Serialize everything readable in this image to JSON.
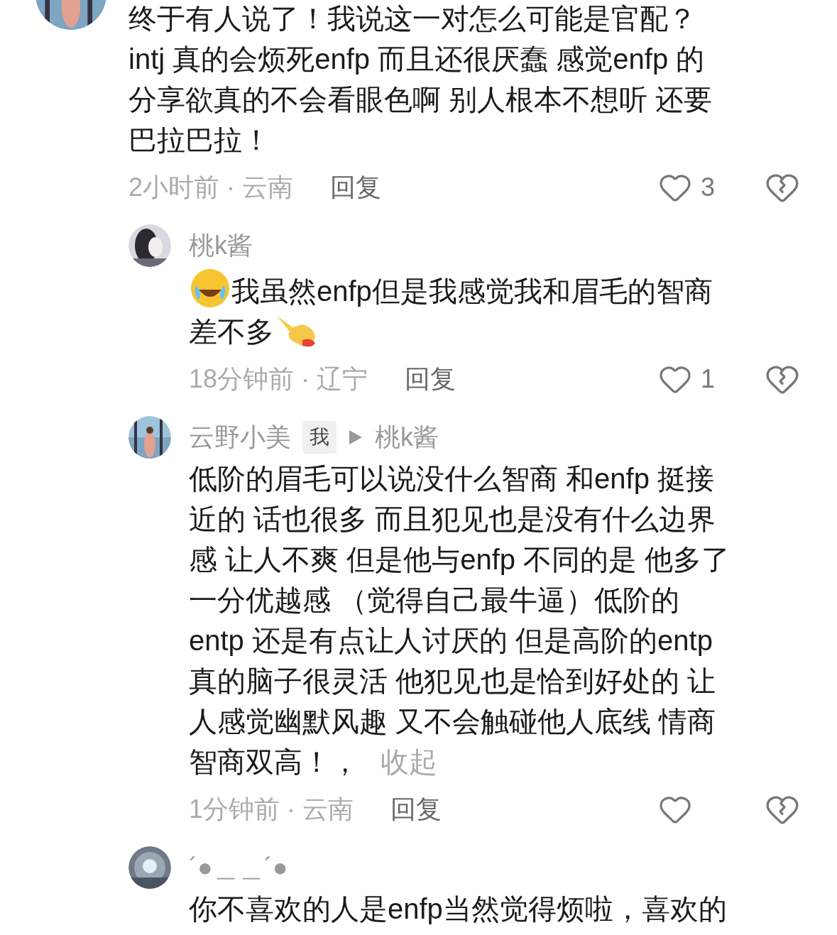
{
  "comment": {
    "lines": [
      [
        {
          "kind": "text",
          "text": "终于有人说了！我说这一对怎么可能是官配？"
        }
      ],
      [
        {
          "kind": "text",
          "text": "intj 真的会烦死enfp 而且还很厌蠢 感觉enfp 的"
        }
      ],
      [
        {
          "kind": "text",
          "text": "分享欲真的不会看眼色啊 别人根本不想听 还要"
        }
      ],
      [
        {
          "kind": "text",
          "text": "巴拉巴拉！"
        }
      ]
    ],
    "time": "2小时前 · 云南",
    "reply": "回复",
    "likes": "3"
  },
  "replies": [
    {
      "name": "桃k酱",
      "lines": [
        [
          {
            "kind": "laugh_emoji"
          },
          {
            "kind": "text",
            "text": "我虽然enfp但是我感觉我和眉毛的智商"
          }
        ],
        [
          {
            "kind": "text",
            "text": "差不多"
          },
          {
            "kind": "point_emoji"
          }
        ]
      ],
      "time": "18分钟前 · 辽宁",
      "reply": "回复",
      "likes": "1"
    },
    {
      "name": "云野小美",
      "badge": "我",
      "reply_to": "桃k酱",
      "lines": [
        [
          {
            "kind": "text",
            "text": "低阶的眉毛可以说没什么智商 和enfp 挺接"
          }
        ],
        [
          {
            "kind": "text",
            "text": "近的 话也很多 而且犯见也是没有什么边界"
          }
        ],
        [
          {
            "kind": "text",
            "text": "感 让人不爽 但是他与enfp 不同的是 他多了"
          }
        ],
        [
          {
            "kind": "text",
            "text": "一分优越感 （觉得自己最牛逼）低阶的"
          }
        ],
        [
          {
            "kind": "text",
            "text": "entp 还是有点让人讨厌的 但是高阶的entp"
          }
        ],
        [
          {
            "kind": "text",
            "text": "真的脑子很灵活 他犯见也是恰到好处的 让"
          }
        ],
        [
          {
            "kind": "text",
            "text": "人感觉幽默风趣 又不会触碰他人底线 情商"
          }
        ],
        [
          {
            "kind": "text",
            "text": "智商双高！，"
          }
        ]
      ],
      "collapse": "收起",
      "time": "1分钟前 · 云南",
      "reply": "回复"
    },
    {
      "name": "´●＿＿´●",
      "lines": [
        [
          {
            "kind": "text",
            "text": "你不喜欢的人是enfp当然觉得烦啦，喜欢的"
          }
        ]
      ]
    }
  ]
}
